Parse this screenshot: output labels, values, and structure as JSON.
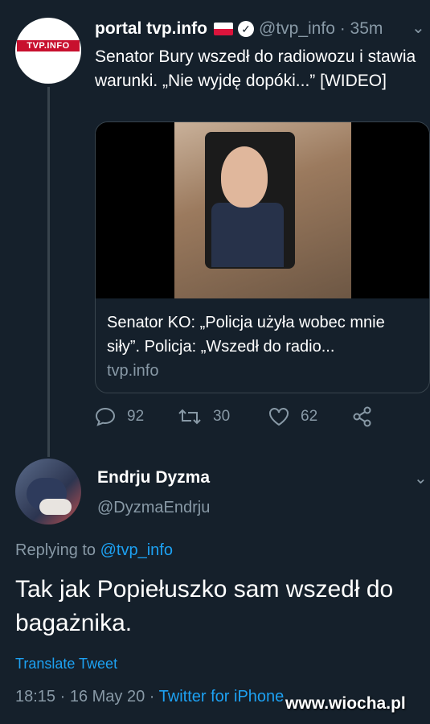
{
  "tweet1": {
    "name": "portal tvp.info",
    "handle": "@tvp_info",
    "time": "35m",
    "logo_text": "TVP.INFO",
    "text": "Senator Bury wszedł do radiowozu i stawia warunki. „Nie wyjdę dopóki...” [WIDEO]",
    "card": {
      "title": "Senator KO: „Policja użyła wobec mnie siły”. Policja: „Wszedł do radio...",
      "domain": "tvp.info"
    },
    "actions": {
      "replies": "92",
      "retweets": "30",
      "likes": "62"
    }
  },
  "tweet2": {
    "name": "Endrju Dyzma",
    "handle": "@DyzmaEndrju",
    "replying_label": "Replying to",
    "replying_to": "@tvp_info",
    "text": "Tak jak Popiełuszko sam wszedł do bagażnika.",
    "translate": "Translate Tweet",
    "time": "18:15",
    "date": "16 May 20",
    "source": "Twitter for iPhone"
  },
  "watermark": "www.wiocha.pl",
  "colors": {
    "background": "#15202b",
    "muted": "#8899a6",
    "link": "#1da1f2",
    "border": "#38444d"
  }
}
